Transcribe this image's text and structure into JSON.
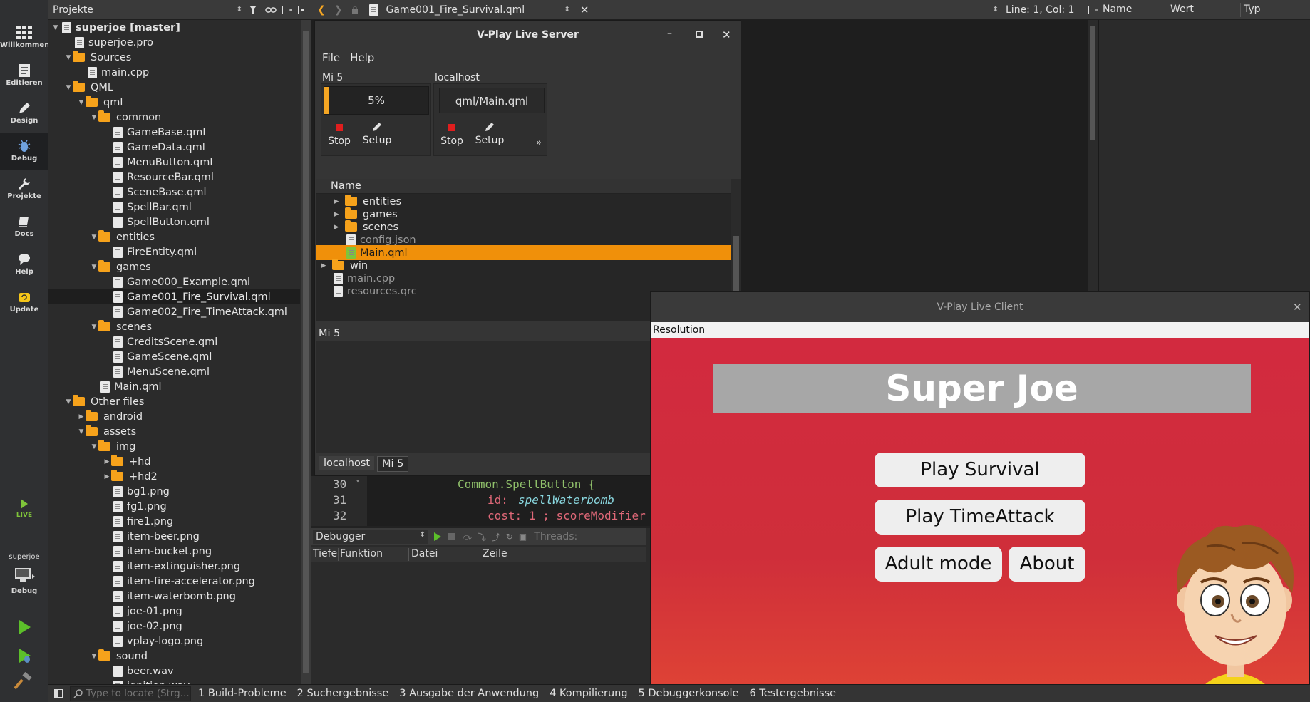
{
  "modes": [
    {
      "label": "Willkommen",
      "icon": "grid-icon"
    },
    {
      "label": "Editieren",
      "icon": "edit-doc-icon"
    },
    {
      "label": "Design",
      "icon": "pen-icon"
    },
    {
      "label": "Debug",
      "icon": "bug-icon"
    },
    {
      "label": "Projekte",
      "icon": "wrench-icon"
    },
    {
      "label": "Docs",
      "icon": "book-icon"
    },
    {
      "label": "Help",
      "icon": "speech-icon"
    },
    {
      "label": "Update",
      "icon": "update-icon"
    }
  ],
  "live_label": "LIVE",
  "kit": {
    "project": "superjoe",
    "config": "Debug"
  },
  "projects_pane": {
    "title": "Projekte"
  },
  "tree": [
    {
      "label": "superjoe [master]",
      "depth": 0,
      "kind": "project",
      "open": true
    },
    {
      "label": "superjoe.pro",
      "depth": 1,
      "kind": "file"
    },
    {
      "label": "Sources",
      "depth": 1,
      "kind": "folder",
      "open": true
    },
    {
      "label": "main.cpp",
      "depth": 2,
      "kind": "file"
    },
    {
      "label": "QML",
      "depth": 1,
      "kind": "folder",
      "open": true
    },
    {
      "label": "qml",
      "depth": 2,
      "kind": "folder",
      "open": true
    },
    {
      "label": "common",
      "depth": 3,
      "kind": "folder",
      "open": true
    },
    {
      "label": "GameBase.qml",
      "depth": 4,
      "kind": "file"
    },
    {
      "label": "GameData.qml",
      "depth": 4,
      "kind": "file"
    },
    {
      "label": "MenuButton.qml",
      "depth": 4,
      "kind": "file"
    },
    {
      "label": "ResourceBar.qml",
      "depth": 4,
      "kind": "file"
    },
    {
      "label": "SceneBase.qml",
      "depth": 4,
      "kind": "file"
    },
    {
      "label": "SpellBar.qml",
      "depth": 4,
      "kind": "file"
    },
    {
      "label": "SpellButton.qml",
      "depth": 4,
      "kind": "file"
    },
    {
      "label": "entities",
      "depth": 3,
      "kind": "folder",
      "open": true
    },
    {
      "label": "FireEntity.qml",
      "depth": 4,
      "kind": "file"
    },
    {
      "label": "games",
      "depth": 3,
      "kind": "folder",
      "open": true
    },
    {
      "label": "Game000_Example.qml",
      "depth": 4,
      "kind": "file"
    },
    {
      "label": "Game001_Fire_Survival.qml",
      "depth": 4,
      "kind": "file",
      "selected": true
    },
    {
      "label": "Game002_Fire_TimeAttack.qml",
      "depth": 4,
      "kind": "file"
    },
    {
      "label": "scenes",
      "depth": 3,
      "kind": "folder",
      "open": true
    },
    {
      "label": "CreditsScene.qml",
      "depth": 4,
      "kind": "file"
    },
    {
      "label": "GameScene.qml",
      "depth": 4,
      "kind": "file"
    },
    {
      "label": "MenuScene.qml",
      "depth": 4,
      "kind": "file"
    },
    {
      "label": "Main.qml",
      "depth": 3,
      "kind": "file"
    },
    {
      "label": "Other files",
      "depth": 1,
      "kind": "folder",
      "open": true
    },
    {
      "label": "android",
      "depth": 2,
      "kind": "folder",
      "open": false
    },
    {
      "label": "assets",
      "depth": 2,
      "kind": "folder",
      "open": true
    },
    {
      "label": "img",
      "depth": 3,
      "kind": "folder",
      "open": true
    },
    {
      "label": "+hd",
      "depth": 4,
      "kind": "folder",
      "open": false
    },
    {
      "label": "+hd2",
      "depth": 4,
      "kind": "folder",
      "open": false
    },
    {
      "label": "bg1.png",
      "depth": 4,
      "kind": "file"
    },
    {
      "label": "fg1.png",
      "depth": 4,
      "kind": "file"
    },
    {
      "label": "fire1.png",
      "depth": 4,
      "kind": "file"
    },
    {
      "label": "item-beer.png",
      "depth": 4,
      "kind": "file"
    },
    {
      "label": "item-bucket.png",
      "depth": 4,
      "kind": "file"
    },
    {
      "label": "item-extinguisher.png",
      "depth": 4,
      "kind": "file"
    },
    {
      "label": "item-fire-accelerator.png",
      "depth": 4,
      "kind": "file"
    },
    {
      "label": "item-waterbomb.png",
      "depth": 4,
      "kind": "file"
    },
    {
      "label": "joe-01.png",
      "depth": 4,
      "kind": "file"
    },
    {
      "label": "joe-02.png",
      "depth": 4,
      "kind": "file"
    },
    {
      "label": "vplay-logo.png",
      "depth": 4,
      "kind": "file"
    },
    {
      "label": "sound",
      "depth": 3,
      "kind": "folder",
      "open": true
    },
    {
      "label": "beer.wav",
      "depth": 4,
      "kind": "file"
    },
    {
      "label": "ignition.wav",
      "depth": 4,
      "kind": "file"
    }
  ],
  "editor": {
    "file_tab": "Game001_Fire_Survival.qml",
    "cursor": "Line: 1, Col: 1"
  },
  "vars": {
    "columns": [
      "Name",
      "Wert",
      "Typ"
    ]
  },
  "server": {
    "title": "V-Play Live Server",
    "menu": [
      "File",
      "Help"
    ],
    "devices": [
      {
        "name": "Mi 5",
        "progress_text": "5%",
        "progress": 0.05,
        "stop": "Stop",
        "setup": "Setup"
      },
      {
        "name": "localhost",
        "file": "qml/Main.qml",
        "stop": "Stop",
        "setup": "Setup"
      }
    ],
    "more": "»",
    "tree_header": "Name",
    "files": [
      {
        "label": "entities",
        "depth": 1,
        "kind": "folder",
        "expandable": true
      },
      {
        "label": "games",
        "depth": 1,
        "kind": "folder",
        "expandable": true
      },
      {
        "label": "scenes",
        "depth": 1,
        "kind": "folder",
        "expandable": true
      },
      {
        "label": "config.json",
        "depth": 1,
        "kind": "file",
        "dim": true
      },
      {
        "label": "Main.qml",
        "depth": 1,
        "kind": "qml",
        "selected": true
      },
      {
        "label": "win",
        "depth": 0,
        "kind": "folder",
        "expandable": true
      },
      {
        "label": "main.cpp",
        "depth": 0,
        "kind": "file",
        "dim": true
      },
      {
        "label": "resources.qrc",
        "depth": 0,
        "kind": "file",
        "dim": true
      }
    ],
    "log_title": "Mi 5",
    "log_tabs": [
      "localhost",
      "Mi 5"
    ]
  },
  "code": [
    {
      "line": "30",
      "text": "Common.SpellButton {"
    },
    {
      "line": "31",
      "key": "id: ",
      "val": "spellWaterbomb"
    },
    {
      "line": "32",
      "key": "cost: ",
      "val": "1 ; scoreModifier"
    }
  ],
  "debugger": {
    "selector": "Debugger",
    "threads": "Threads:",
    "columns": [
      "Tiefe",
      "Funktion",
      "Datei",
      "Zeile"
    ]
  },
  "client": {
    "title": "V-Play Live Client",
    "resolution": "Resolution",
    "game_title": "Super Joe",
    "buttons": [
      "Play Survival",
      "Play TimeAttack",
      "Adult mode",
      "About"
    ]
  },
  "status": {
    "locate_placeholder": "Type to locate (Strg...",
    "tabs": [
      "1 Build-Probleme",
      "2 Suchergebnisse",
      "3 Ausgabe der Anwendung",
      "4 Kompilierung",
      "5 Debuggerkonsole",
      "6 Testergebnisse"
    ]
  },
  "colors": {
    "accent": "#f0900a",
    "folder": "#f6a21b",
    "stop": "#e01e1e",
    "game_bg": "#d22a3f",
    "game_title_bg": "#a7a7a7"
  }
}
